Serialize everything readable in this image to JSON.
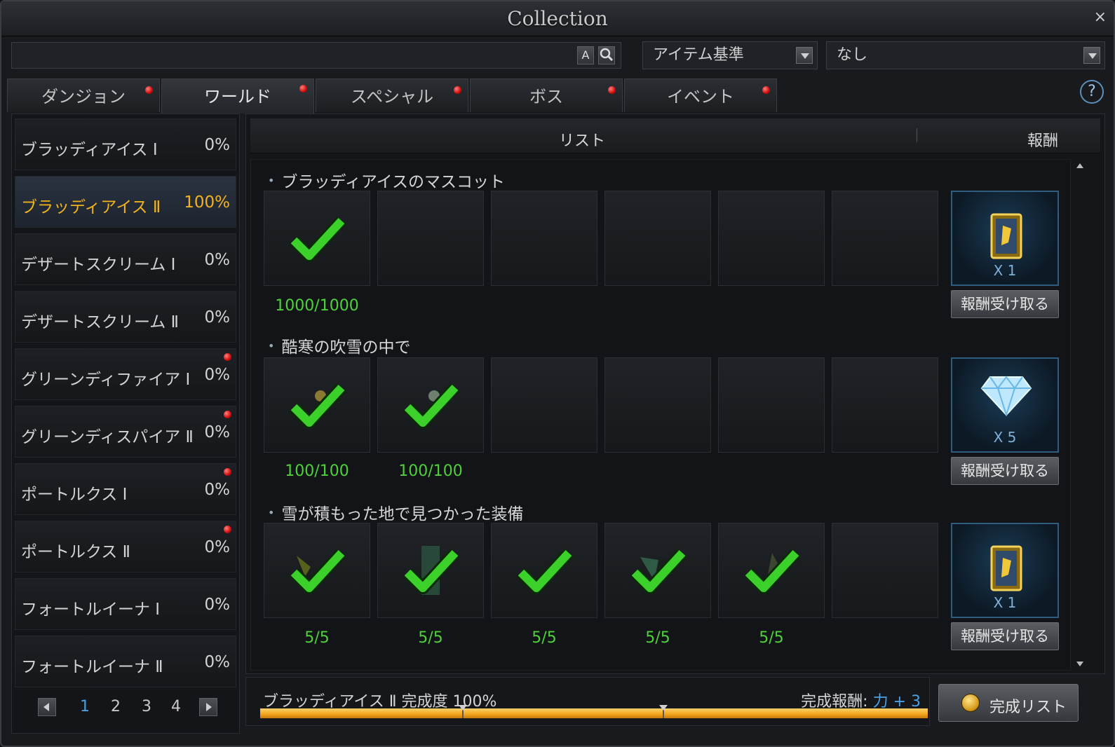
{
  "window": {
    "title": "Collection",
    "close": "×"
  },
  "search": {
    "value": "",
    "placeholder": "",
    "btn_a": "A",
    "btn_search": "🔍"
  },
  "filters": {
    "sort": "アイテム基準",
    "category": "なし"
  },
  "tabs": [
    {
      "label": "ダンジョン",
      "alert": true
    },
    {
      "label": "ワールド",
      "alert": true,
      "active": true
    },
    {
      "label": "スペシャル",
      "alert": true
    },
    {
      "label": "ボス",
      "alert": true
    },
    {
      "label": "イベント",
      "alert": true
    }
  ],
  "help": "?",
  "left_list": [
    {
      "name": "ブラッディアイス Ⅰ",
      "pct": "0%",
      "alert": false
    },
    {
      "name": "ブラッディアイス Ⅱ",
      "pct": "100%",
      "alert": false,
      "active": true
    },
    {
      "name": "デザートスクリーム Ⅰ",
      "pct": "0%",
      "alert": false
    },
    {
      "name": "デザートスクリーム Ⅱ",
      "pct": "0%",
      "alert": false
    },
    {
      "name": "グリーンディファイア Ⅰ",
      "pct": "0%",
      "alert": true
    },
    {
      "name": "グリーンディスパイア Ⅱ",
      "pct": "0%",
      "alert": true
    },
    {
      "name": "ポートルクス Ⅰ",
      "pct": "0%",
      "alert": true
    },
    {
      "name": "ポートルクス Ⅱ",
      "pct": "0%",
      "alert": true
    },
    {
      "name": "フォートルイーナ Ⅰ",
      "pct": "0%",
      "alert": false
    },
    {
      "name": "フォートルイーナ Ⅱ",
      "pct": "0%",
      "alert": false
    }
  ],
  "pager": {
    "pages": [
      "1",
      "2",
      "3",
      "4"
    ],
    "current": "1"
  },
  "right_header": {
    "list": "リスト",
    "reward": "報酬"
  },
  "sections": [
    {
      "title": "ブラッディアイスのマスコット",
      "slots": [
        {
          "count": "1000/1000"
        }
      ],
      "reward_qty": "X 1",
      "reward_icon": "card-icon",
      "reward_btn": "報酬受け取る"
    },
    {
      "title": "酷寒の吹雪の中で",
      "slots": [
        {
          "count": "100/100"
        },
        {
          "count": "100/100"
        }
      ],
      "reward_qty": "X 5",
      "reward_icon": "diamond-icon",
      "reward_btn": "報酬受け取る"
    },
    {
      "title": "雪が積もった地で見つかった装備",
      "slots": [
        {
          "count": "5/5"
        },
        {
          "count": "5/5"
        },
        {
          "count": "5/5"
        },
        {
          "count": "5/5"
        },
        {
          "count": "5/5"
        }
      ],
      "reward_qty": "X 1",
      "reward_icon": "card-icon",
      "reward_btn": "報酬受け取る"
    }
  ],
  "footer": {
    "progress_text": "ブラッディアイス Ⅱ 完成度 100%",
    "progress": 1.0,
    "reward_label": "完成報酬:",
    "reward_value": "力 + 3",
    "complete_list": "完成リスト"
  },
  "colors": {
    "check": "#3bd12a",
    "progress": "#f0a31a",
    "accent": "#f1b21c",
    "count": "#4ed13a"
  }
}
